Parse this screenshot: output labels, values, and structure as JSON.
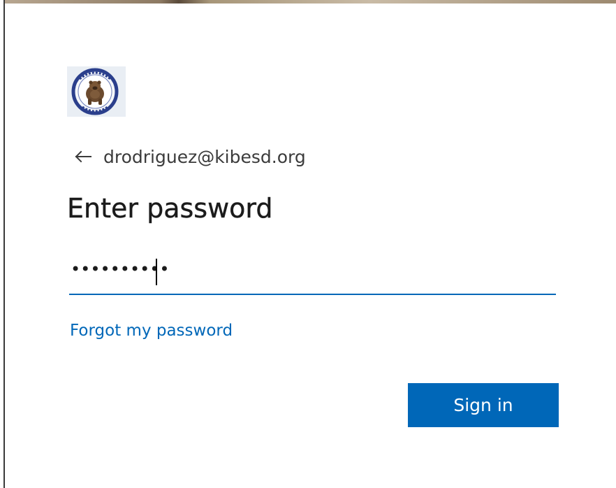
{
  "account": {
    "email": "drodriguez@kibesd.org"
  },
  "page": {
    "title": "Enter password"
  },
  "password_field": {
    "masked_value": "••••••••••"
  },
  "links": {
    "forgot_password": "Forgot my password"
  },
  "buttons": {
    "sign_in": "Sign in"
  },
  "icons": {
    "back": "arrow-left-icon",
    "logo": "school-district-logo"
  },
  "colors": {
    "accent": "#0067b8",
    "text": "#1b1b1b",
    "subtle_text": "#3b3b3b"
  }
}
